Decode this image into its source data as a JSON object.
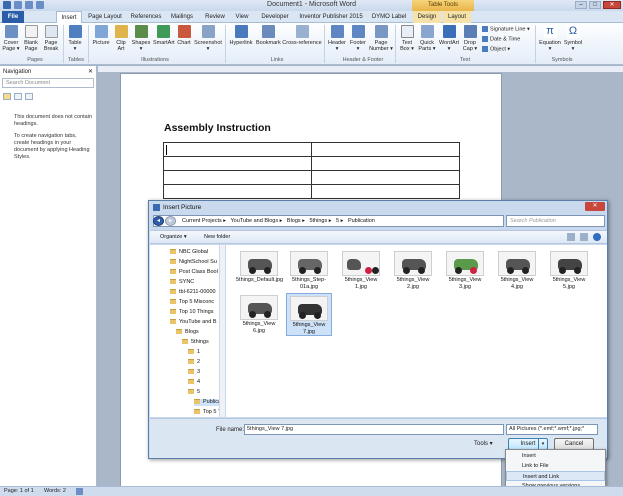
{
  "window": {
    "title": "Document1 - Microsoft Word",
    "contextual_tab_group": "Table Tools"
  },
  "tabs": [
    {
      "label": "File"
    },
    {
      "label": "Insert"
    },
    {
      "label": "Page Layout"
    },
    {
      "label": "References"
    },
    {
      "label": "Mailings"
    },
    {
      "label": "Review"
    },
    {
      "label": "View"
    },
    {
      "label": "Developer"
    },
    {
      "label": "Inventor Publisher 2015"
    },
    {
      "label": "DYMO Label"
    },
    {
      "label": "Design"
    },
    {
      "label": "Layout"
    }
  ],
  "ribbon": {
    "buttons": {
      "cover_page": "Cover\nPage ▾",
      "blank_page": "Blank\nPage",
      "page_break": "Page\nBreak",
      "table": "Table\n▾",
      "picture": "Picture",
      "clip_art": "Clip\nArt",
      "shapes": "Shapes\n▾",
      "smartart": "SmartArt",
      "chart": "Chart",
      "screenshot": "Screenshot\n▾",
      "hyperlink": "Hyperlink",
      "bookmark": "Bookmark",
      "cross_reference": "Cross-reference",
      "header": "Header\n▾",
      "footer": "Footer\n▾",
      "page_number": "Page\nNumber ▾",
      "text_box": "Text\nBox ▾",
      "quick_parts": "Quick\nParts ▾",
      "wordart": "WordArt\n▾",
      "drop_cap": "Drop\nCap ▾",
      "equation": "Equation\n▾",
      "symbol": "Symbol\n▾"
    },
    "small": {
      "signature_line": "Signature Line ▾",
      "date_time": "Date & Time",
      "object": "Object ▾"
    },
    "groups": {
      "pages": "Pages",
      "tables": "Tables",
      "illustrations": "Illustrations",
      "links": "Links",
      "header_footer": "Header & Footer",
      "text": "Text",
      "symbols": "Symbols"
    }
  },
  "nav": {
    "title": "Navigation",
    "close": "✕",
    "search_placeholder": "Search Document",
    "msg1": "This document does not contain headings.",
    "msg2": "To create navigation tabs, create headings in your document by applying Heading Styles."
  },
  "document": {
    "heading": "Assembly Instruction"
  },
  "dialog": {
    "title": "Insert Picture",
    "close": "✕",
    "breadcrumbs": [
      "Current Projects ▸",
      "YouTube and Blogs ▸",
      "Blogs ▸",
      "5things ▸",
      "5 ▸",
      "Publication"
    ],
    "search_placeholder": "Search Publication",
    "organize": "Organize ▾",
    "new_folder": "New folder",
    "tree": [
      "NBC Global",
      "NightSchool Su",
      "Post Class Bool",
      "SYNC",
      "tbl-6211-00000",
      "Top 5 Misconc",
      "Top 10 Things",
      "YouTube and B",
      "Blogs",
      "5things",
      "1",
      "2",
      "3",
      "4",
      "5",
      "Publica",
      "Top 5 T"
    ],
    "files": [
      {
        "name": "5things_Default.jpg"
      },
      {
        "name": "5things_Step-01a.jpg"
      },
      {
        "name": "5things_View 1.jpg"
      },
      {
        "name": "5things_View 2.jpg"
      },
      {
        "name": "5things_View 3.jpg"
      },
      {
        "name": "5things_View 4.jpg"
      },
      {
        "name": "5things_View 5.jpg"
      },
      {
        "name": "5things_View 6.jpg"
      },
      {
        "name": "5things_View 7.jpg"
      }
    ],
    "file_name_label": "File name:",
    "file_name_value": "5things_View 7.jpg",
    "filter": "All Pictures (*.emf;*.wmf;*.jpg;*",
    "tools": "Tools ▾",
    "insert": "Insert",
    "cancel": "Cancel",
    "menu": [
      "Insert",
      "Link to File",
      "Insert and Link",
      "Show previous versions"
    ]
  },
  "status": {
    "page": "Page: 1 of 1",
    "words": "Words: 2"
  }
}
